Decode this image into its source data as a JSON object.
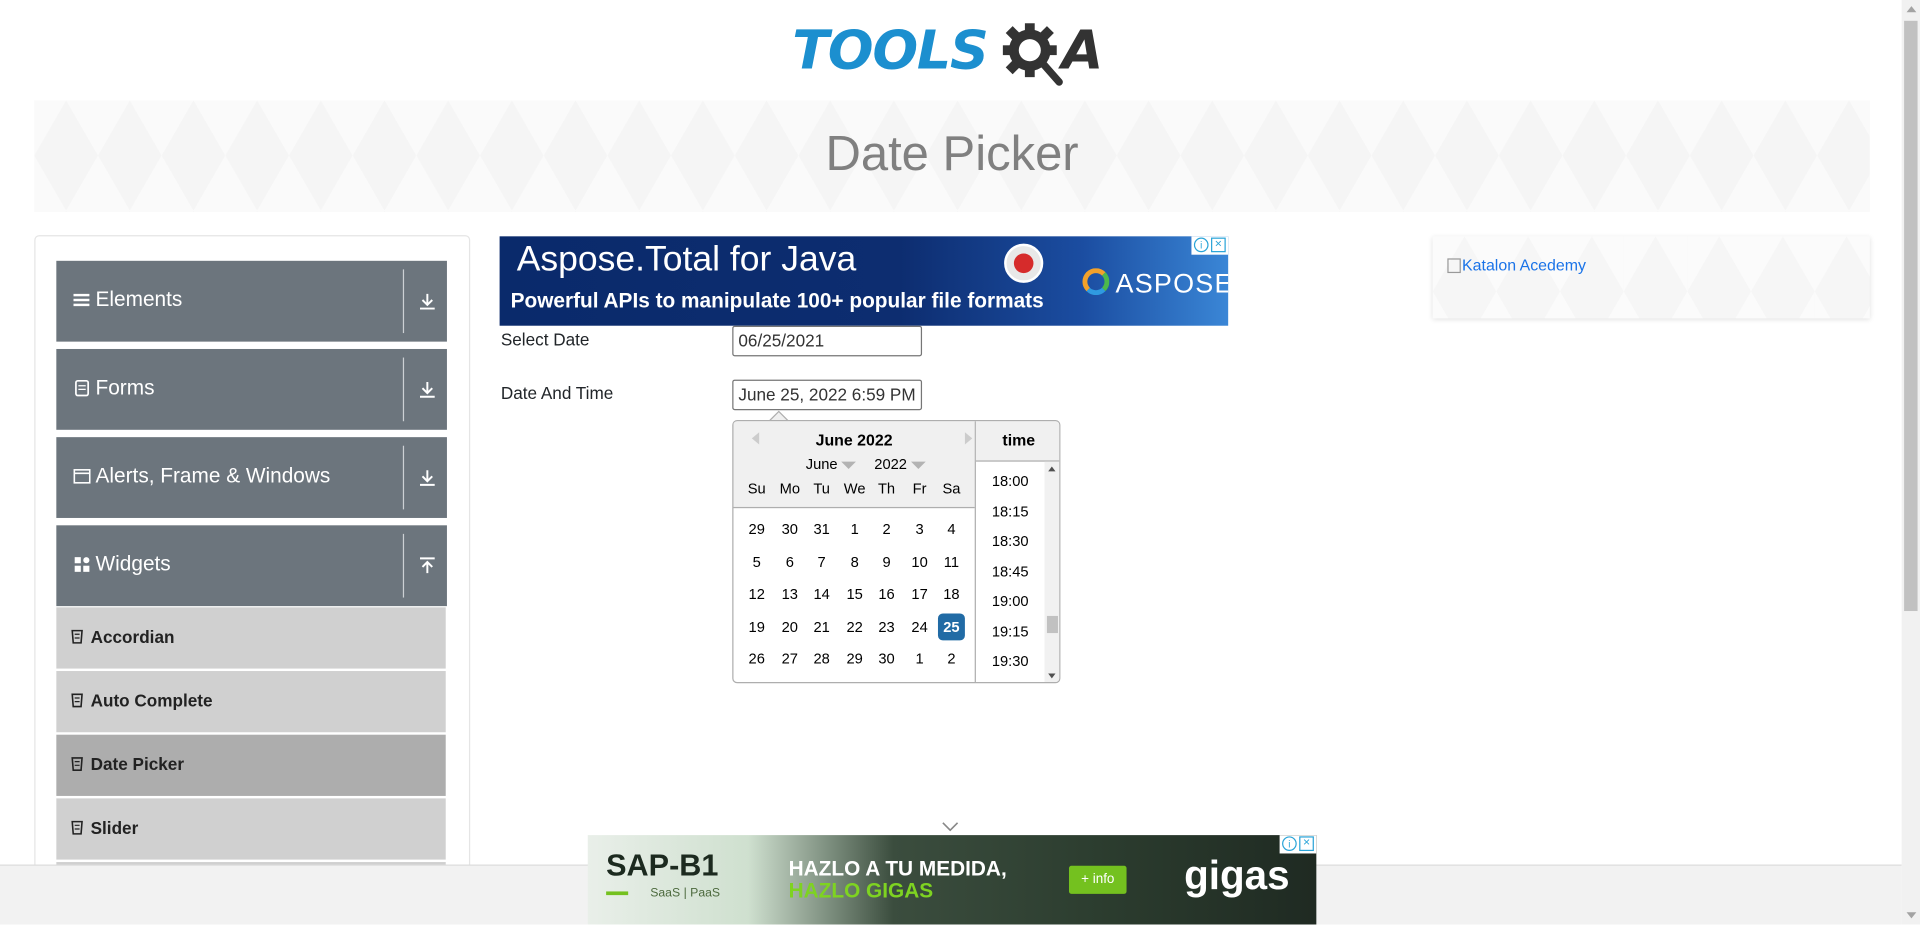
{
  "header": {
    "logo_text": "TOOLS",
    "logo_suffix": "A",
    "page_title": "Date Picker"
  },
  "sidebar": {
    "groups": [
      {
        "label": "Elements",
        "icon": "hamburger-icon"
      },
      {
        "label": "Forms",
        "icon": "document-icon"
      },
      {
        "label": "Alerts, Frame & Windows",
        "icon": "window-icon"
      },
      {
        "label": "Widgets",
        "icon": "grid-icon"
      }
    ],
    "items": [
      {
        "label": "Accordian"
      },
      {
        "label": "Auto Complete"
      },
      {
        "label": "Date Picker",
        "active": true
      },
      {
        "label": "Slider"
      }
    ]
  },
  "ads": {
    "top": {
      "headline": "Aspose.Total for Java",
      "tagline": "Powerful APIs to manipulate 100+ popular file formats",
      "brand": "ASPOSE"
    },
    "right": {
      "alt_text": "Katalon Acedemy"
    },
    "bottom": {
      "product": "SAP-B1",
      "subline": "SaaS | PaaS",
      "headline_1": "HAZLO A TU MEDIDA,",
      "headline_2": "HAZLO GIGAS",
      "button": "+ info",
      "brand": "gigas"
    }
  },
  "form": {
    "select_date_label": "Select Date",
    "select_date_value": "06/25/2021",
    "date_time_label": "Date And Time",
    "date_time_value": "June 25, 2022 6:59 PM"
  },
  "datepicker": {
    "month_title": "June 2022",
    "month_select": "June",
    "year_select": "2022",
    "day_names": [
      "Su",
      "Mo",
      "Tu",
      "We",
      "Th",
      "Fr",
      "Sa"
    ],
    "weeks": [
      [
        "29",
        "30",
        "31",
        "1",
        "2",
        "3",
        "4"
      ],
      [
        "5",
        "6",
        "7",
        "8",
        "9",
        "10",
        "11"
      ],
      [
        "12",
        "13",
        "14",
        "15",
        "16",
        "17",
        "18"
      ],
      [
        "19",
        "20",
        "21",
        "22",
        "23",
        "24",
        "25"
      ],
      [
        "26",
        "27",
        "28",
        "29",
        "30",
        "1",
        "2"
      ]
    ],
    "selected_day": "25",
    "time_header": "time",
    "time_slots": [
      "18:00",
      "18:15",
      "18:30",
      "18:45",
      "19:00",
      "19:15",
      "19:30"
    ]
  },
  "colors": {
    "sidebar_group": "#6c757d",
    "sidebar_item": "#d0d0d0",
    "sidebar_item_active": "#adadad",
    "selected_day": "#216ba5",
    "logo_blue": "#1c8fcf"
  }
}
